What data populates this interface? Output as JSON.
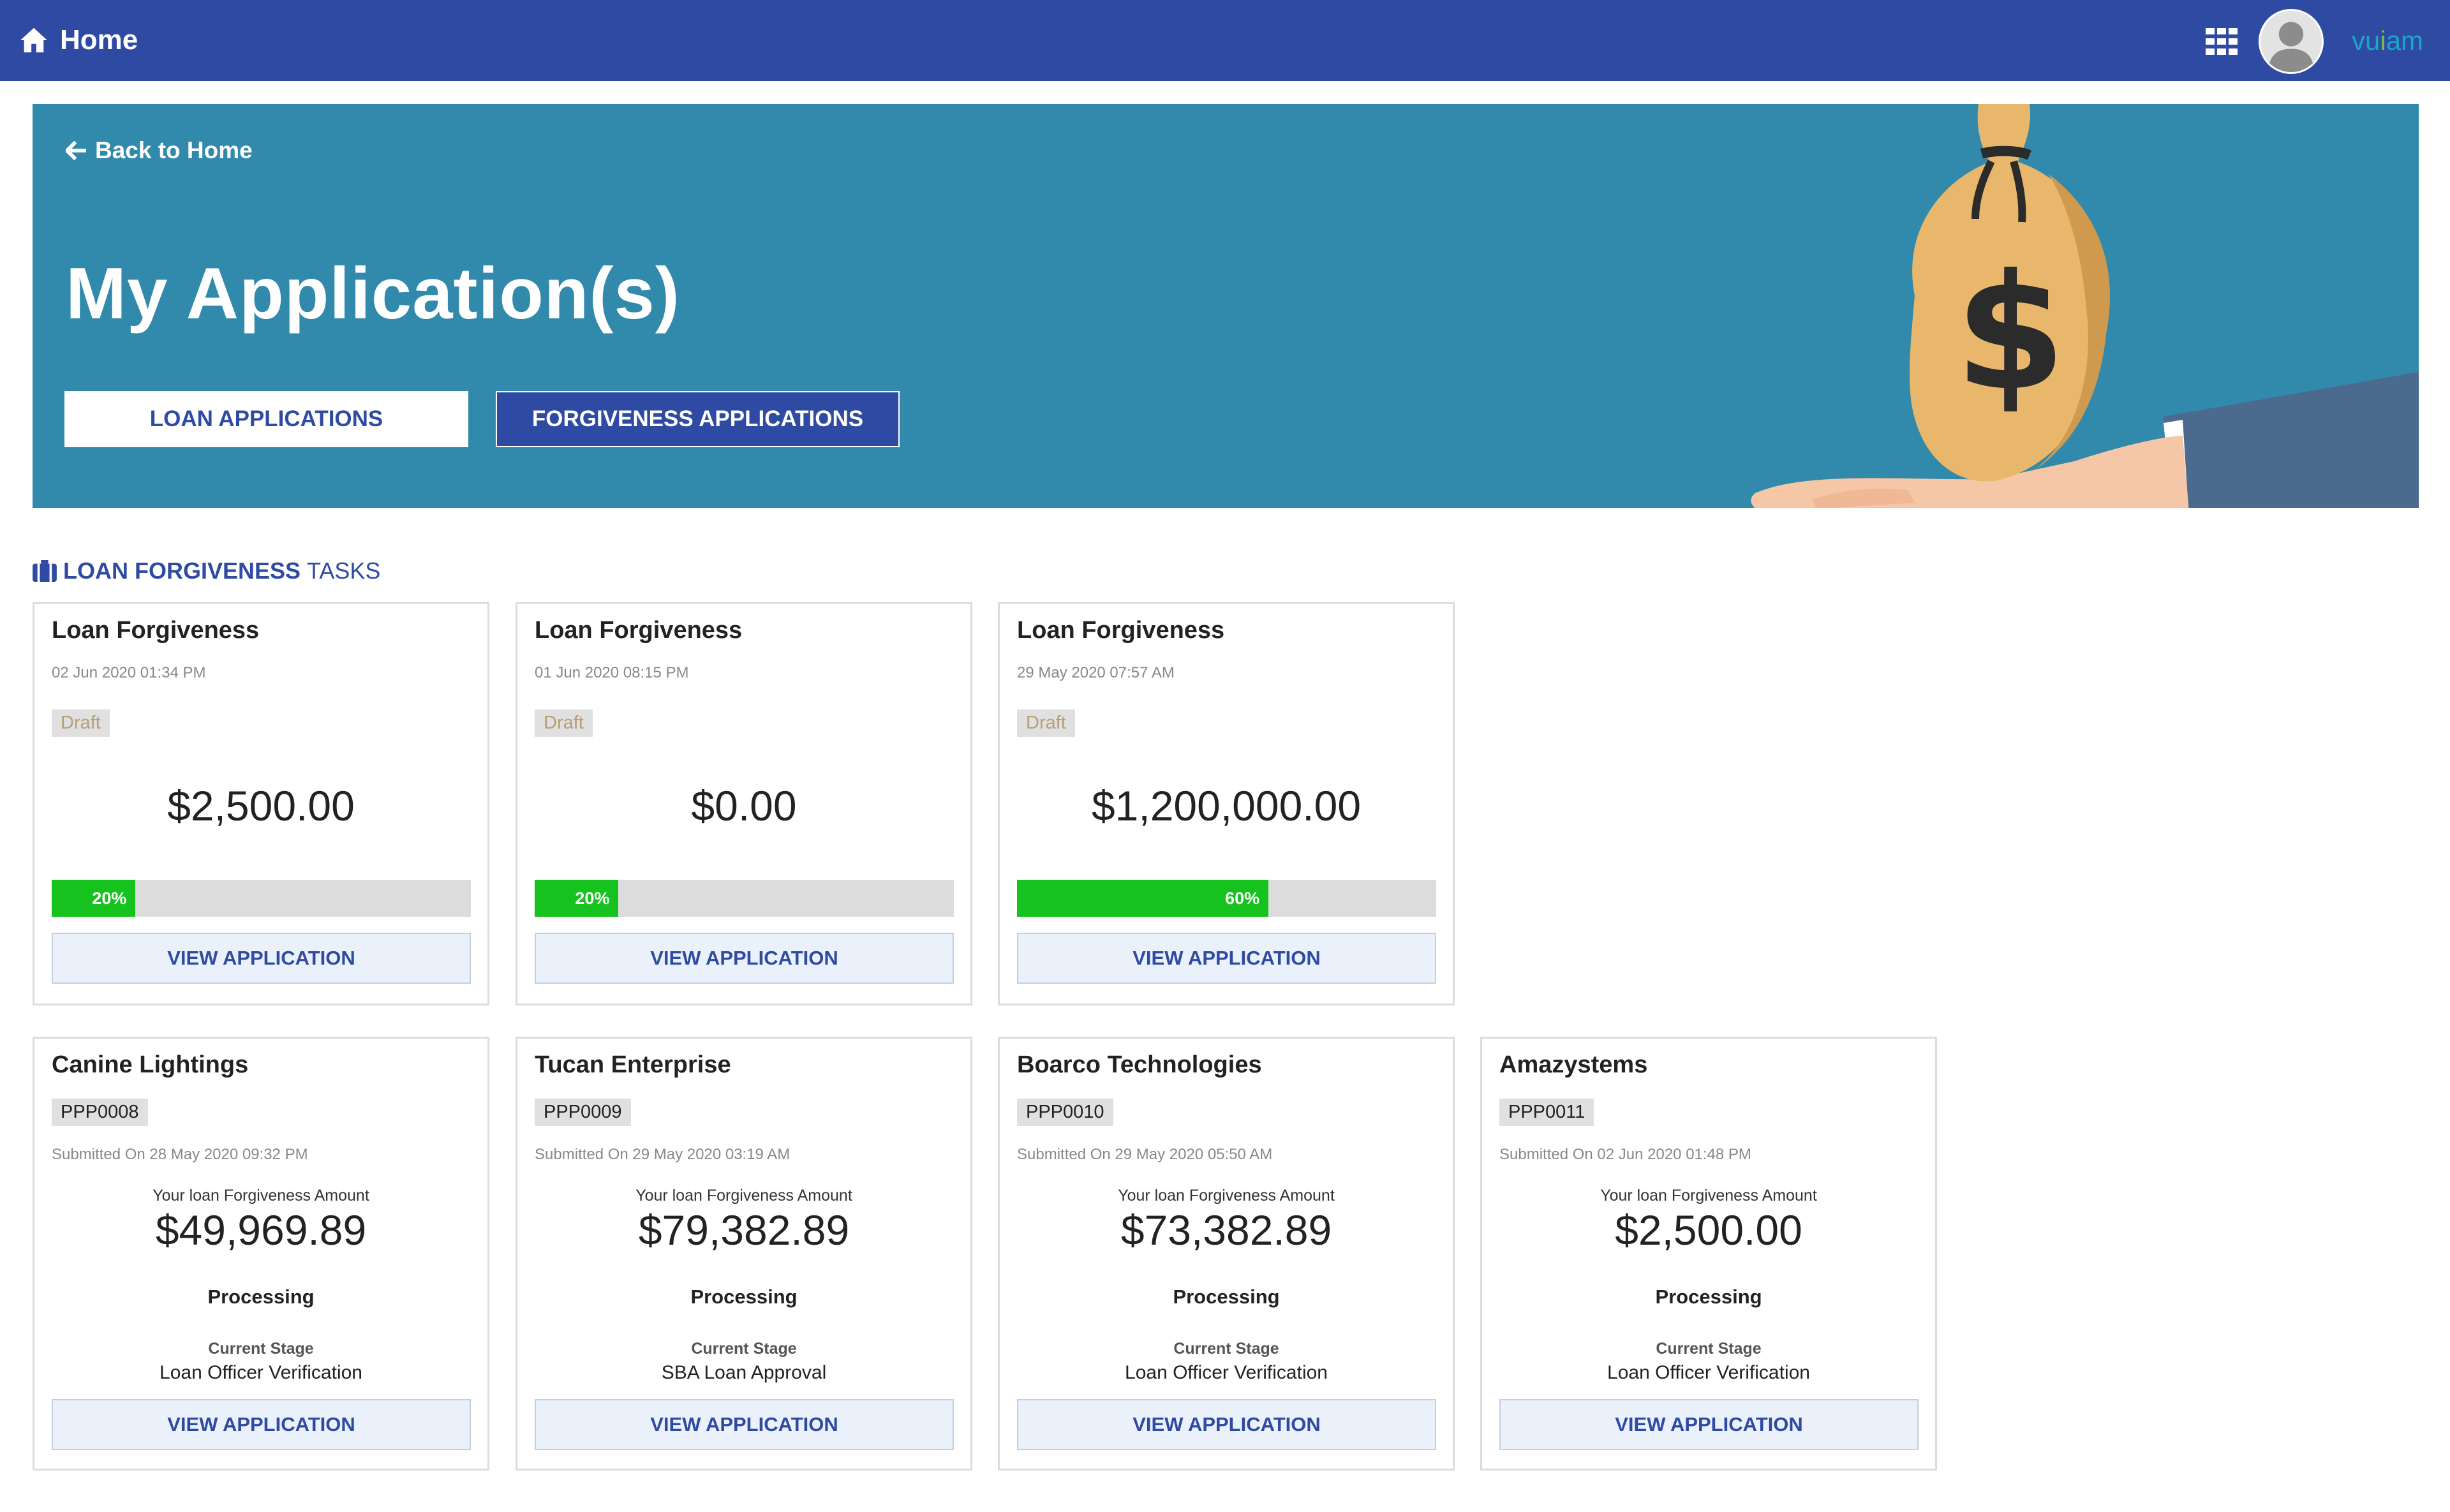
{
  "topbar": {
    "home_label": "Home",
    "brand_prefix": "vu",
    "brand_dot": "i",
    "brand_suffix": "am",
    "icons": {
      "home": "home-icon",
      "apps": "apps-grid-icon",
      "avatar": "user-avatar"
    }
  },
  "hero": {
    "back_label": "Back to Home",
    "title": "My Application(s)",
    "tabs": [
      {
        "label": "LOAN APPLICATIONS",
        "active": false
      },
      {
        "label": "FORGIVENESS APPLICATIONS",
        "active": true
      }
    ]
  },
  "section": {
    "strong": "LOAN FORGIVENESS",
    "light": "TASKS"
  },
  "colors": {
    "primary": "#2f4aa3",
    "hero_bg": "#318aab",
    "progress_fill": "#16c21e",
    "button_bg": "#eaf1fb"
  },
  "drafts": [
    {
      "title": "Loan Forgiveness",
      "date": "02 Jun 2020 01:34 PM",
      "status": "Draft",
      "amount": "$2,500.00",
      "progress_pct": 20,
      "progress_label": "20%",
      "button": "VIEW APPLICATION"
    },
    {
      "title": "Loan Forgiveness",
      "date": "01 Jun 2020 08:15 PM",
      "status": "Draft",
      "amount": "$0.00",
      "progress_pct": 20,
      "progress_label": "20%",
      "button": "VIEW APPLICATION"
    },
    {
      "title": "Loan Forgiveness",
      "date": "29 May 2020 07:57 AM",
      "status": "Draft",
      "amount": "$1,200,000.00",
      "progress_pct": 60,
      "progress_label": "60%",
      "button": "VIEW APPLICATION"
    }
  ],
  "submitted": [
    {
      "company": "Canine Lightings",
      "id": "PPP0008",
      "submitted": "Submitted On 28 May 2020 09:32 PM",
      "amount_label": "Your loan Forgiveness Amount",
      "amount": "$49,969.89",
      "status": "Processing",
      "stage_label": "Current Stage",
      "stage": "Loan Officer Verification",
      "button": "VIEW APPLICATION"
    },
    {
      "company": "Tucan Enterprise",
      "id": "PPP0009",
      "submitted": "Submitted On 29 May 2020 03:19 AM",
      "amount_label": "Your loan Forgiveness Amount",
      "amount": "$79,382.89",
      "status": "Processing",
      "stage_label": "Current Stage",
      "stage": "SBA Loan Approval",
      "button": "VIEW APPLICATION"
    },
    {
      "company": "Boarco Technologies",
      "id": "PPP0010",
      "submitted": "Submitted On 29 May 2020 05:50 AM",
      "amount_label": "Your loan Forgiveness Amount",
      "amount": "$73,382.89",
      "status": "Processing",
      "stage_label": "Current Stage",
      "stage": "Loan Officer Verification",
      "button": "VIEW APPLICATION"
    },
    {
      "company": "Amazystems",
      "id": "PPP0011",
      "submitted": "Submitted On 02 Jun 2020 01:48 PM",
      "amount_label": "Your loan Forgiveness Amount",
      "amount": "$2,500.00",
      "status": "Processing",
      "stage_label": "Current Stage",
      "stage": "Loan Officer Verification",
      "button": "VIEW APPLICATION"
    }
  ]
}
